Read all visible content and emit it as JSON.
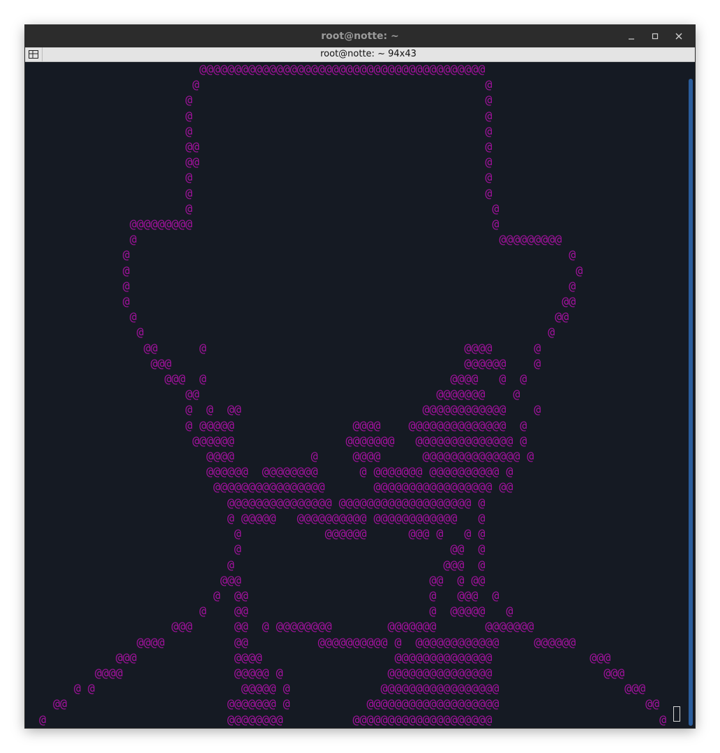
{
  "window": {
    "title": "root@notte: ~",
    "controls": {
      "minimize": "minimize-icon",
      "maximize": "maximize-icon",
      "close": "close-icon"
    }
  },
  "tab": {
    "menu_icon": "terminal-menu-icon",
    "title": "root@notte: ~ 94x43"
  },
  "terminal": {
    "foreground": "#a3129e",
    "background": "#151a23",
    "lines": [
      "                         @@@@@@@@@@@@@@@@@@@@@@@@@@@@@@@@@@@@@@@@@",
      "                        @                                         @",
      "                       @                                          @",
      "                       @                                          @",
      "                       @                                          @",
      "                       @@                                         @",
      "                       @@                                         @",
      "                       @                                          @",
      "                       @                                          @",
      "                       @                                           @",
      "               @@@@@@@@@                                           @",
      "               @                                                    @@@@@@@@@",
      "              @                                                               @",
      "              @                                                                @",
      "              @                                                               @",
      "              @                                                              @@",
      "               @                                                            @@",
      "                @                                                          @",
      "                 @@      @                                     @@@@      @",
      "                  @@@                                          @@@@@@    @",
      "                    @@@  @                                   @@@@   @  @",
      "                       @@                                  @@@@@@@    @",
      "                       @  @  @@                          @@@@@@@@@@@@    @",
      "                       @ @@@@@                 @@@@    @@@@@@@@@@@@@@  @",
      "                        @@@@@@                @@@@@@@   @@@@@@@@@@@@@@ @",
      "                          @@@@           @     @@@@      @@@@@@@@@@@@@@ @",
      "                          @@@@@@  @@@@@@@@      @ @@@@@@@ @@@@@@@@@@ @",
      "                           @@@@@@@@@@@@@@@@       @@@@@@@@@@@@@@@@@ @@",
      "                             @@@@@@@@@@@@@@@ @@@@@@@@@@@@@@@@@@@ @",
      "                             @ @@@@@   @@@@@@@@@@ @@@@@@@@@@@@   @",
      "                              @            @@@@@@      @@@ @   @ @",
      "                              @                              @@  @",
      "                             @                              @@@  @",
      "                            @@@                           @@  @ @@",
      "                           @  @@                          @   @@@  @",
      "                         @    @@                          @  @@@@@   @",
      "                     @@@      @@  @ @@@@@@@@        @@@@@@@       @@@@@@@",
      "                @@@@          @@          @@@@@@@@@@ @  @@@@@@@@@@@@     @@@@@@",
      "             @@@              @@@@                   @@@@@@@@@@@@@@              @@@",
      "          @@@@                @@@@@ @               @@@@@@@@@@@@@@@                @@@",
      "       @ @                     @@@@@ @             @@@@@@@@@@@@@@@@@                  @@@",
      "    @@                       @@@@@@@ @           @@@@@@@@@@@@@@@@@@@                     @@",
      "  @                          @@@@@@@@          @@@@@@@@@@@@@@@@@@@@                        @"
    ]
  }
}
